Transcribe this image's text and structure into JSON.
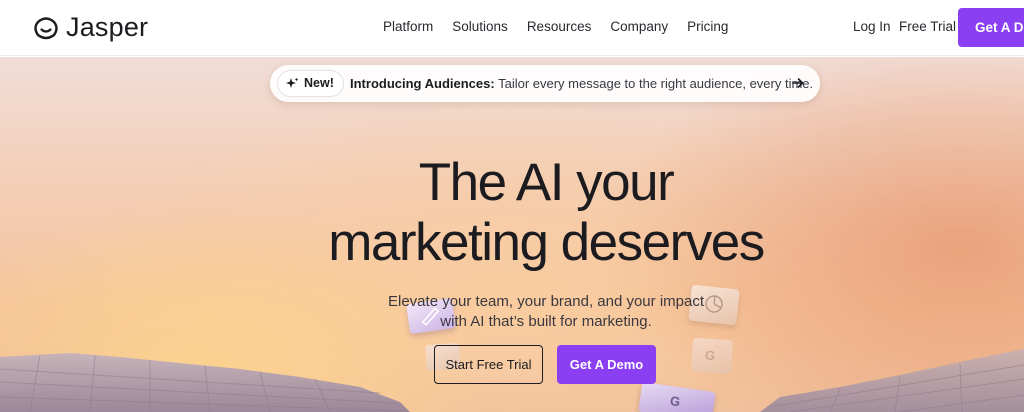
{
  "header": {
    "logo_text": "Jasper",
    "nav": [
      {
        "label": "Platform"
      },
      {
        "label": "Solutions"
      },
      {
        "label": "Resources"
      },
      {
        "label": "Company"
      },
      {
        "label": "Pricing"
      }
    ],
    "login_label": "Log In",
    "free_trial_label": "Free Trial",
    "demo_label": "Get A Demo"
  },
  "banner": {
    "badge": "New!",
    "title": "Introducing Audiences:",
    "text": "Tailor every message to the right audience, every time."
  },
  "hero": {
    "headline_line1": "The AI your",
    "headline_line2": "marketing deserves",
    "sub_line1": "Elevate your team, your brand, and your impact",
    "sub_line2": "with AI that’s built for marketing.",
    "primary_cta": "Start Free Trial",
    "secondary_cta": "Get A Demo"
  },
  "colors": {
    "accent": "#8b3ff3",
    "text": "#1c1b1f"
  },
  "icons": [
    "jasper-logo-icon",
    "sparkle-icon",
    "arrow-right-icon"
  ]
}
